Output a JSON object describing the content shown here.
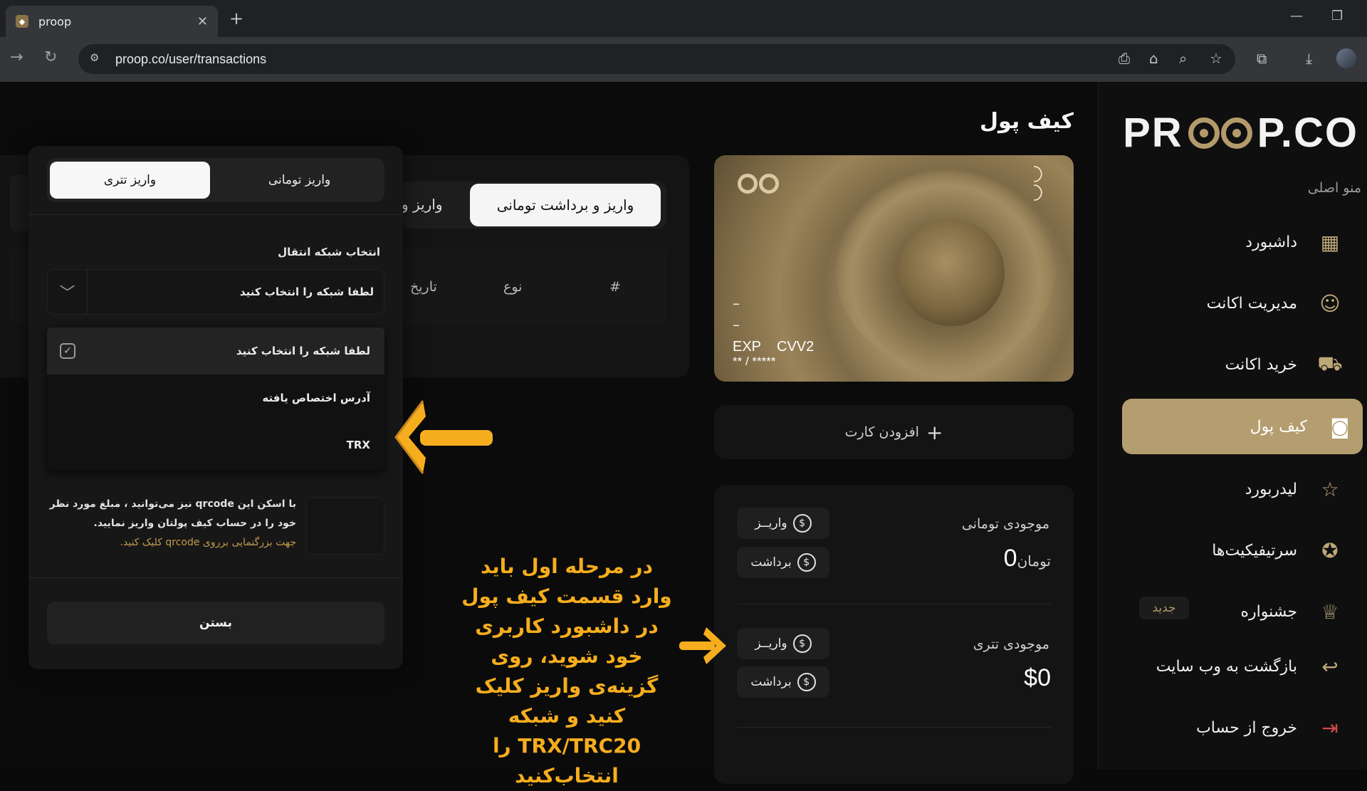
{
  "browser": {
    "tab_title": "proop",
    "url": "proop.co/user/transactions"
  },
  "sidebar": {
    "logo_left": "PR",
    "logo_right": "P.CO",
    "menu_title": "منو اصلی",
    "items": [
      {
        "label": "داشبورد",
        "icon": "grid-icon"
      },
      {
        "label": "مدیریت اکانت",
        "icon": "account-icon"
      },
      {
        "label": "خرید اکانت",
        "icon": "cart-icon"
      },
      {
        "label": "کیف پول",
        "icon": "wallet-icon",
        "active": true
      },
      {
        "label": "لیدربورد",
        "icon": "star-icon"
      },
      {
        "label": "سرتیفیکیت‌ها",
        "icon": "certificate-icon"
      },
      {
        "label": "جشنواره",
        "icon": "trophy-icon",
        "badge": "جدید"
      },
      {
        "label": "بازگشت به وب سایت",
        "icon": "return-icon"
      },
      {
        "label": "خروج از حساب",
        "icon": "logout-icon"
      }
    ]
  },
  "wallet": {
    "title": "کیف پول",
    "card": {
      "line1": "–",
      "line2": "–",
      "exp_label": "EXP",
      "cvv_label": "CVV2",
      "masked": "** / *****"
    },
    "add_card": "افزودن کارت",
    "toman_label": "موجودی تومانی",
    "toman_value": "0",
    "toman_unit": "تومان",
    "tether_label": "موجودی تتری",
    "tether_value": "$0",
    "deposit": "واریــز",
    "withdraw": "برداشت"
  },
  "transactions": {
    "tab_active": "واریز و برداشت تومانی",
    "tab_other": "واریز و",
    "col_hash": "#",
    "col_type": "نوع",
    "col_date": "تاریخ"
  },
  "modal": {
    "tab_tether": "واریز تتری",
    "tab_toman": "واریز تومانی",
    "network_label": "انتخاب شبکه انتقال",
    "select_placeholder": "لطفا شبکه را انتخاب کنید",
    "options": [
      "لطفا شبکه را انتخاب کنید",
      "آدرس اختصاص یافته",
      "TRX"
    ],
    "qr_text": "با اسکن این qrcode نیز می‌توانید ، مبلغ مورد نظر خود را در حساب کیف پولتان واریز نمایید.",
    "qr_link": "جهت بزرگنمایی برروی qrcode کلیک کنید.",
    "close": "بستن"
  },
  "annotation": "در مرحله اول باید وارد قسمت کیف پول در داشبورد کاربری خود شوید، روی گزینه‌ی واریز کلیک کنید و شبکه TRX/TRC20 را انتخاب‌کنید",
  "colors": {
    "accent": "#b49d6f",
    "annotation": "#f6ad1e"
  }
}
